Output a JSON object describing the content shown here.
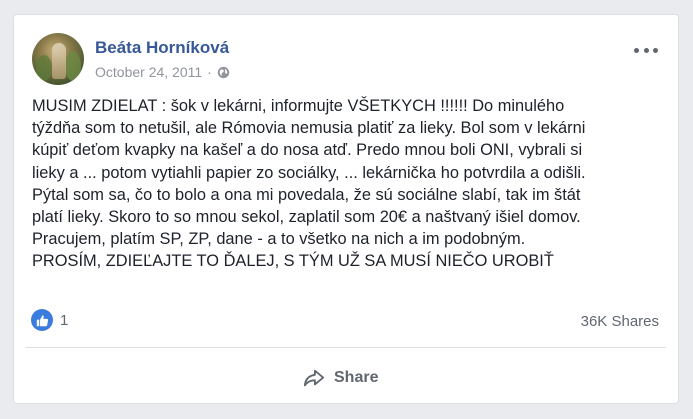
{
  "post": {
    "author_name": "Beáta Horníková",
    "date": "October 24, 2011",
    "separator": "·",
    "audience_icon": "globe-icon",
    "more_icon": "more-horizontal-icon",
    "text_lines": [
      "MUSIM ZDIELAT : šok v lekárni, informujte VŠETKYCH !!!!!! Do minulého",
      "týždňa som to netušil, ale Rómovia nemusia platiť za lieky. Bol som v lekárni",
      "kúpiť deťom kvapky na kašeľ a do nosa atď. Predo mnou boli ONI, vybrali si",
      "lieky a ... potom vytiahli papier zo sociálky, ... lekárnička ho potvrdila a odišli.",
      "Pýtal som sa, čo to bolo a ona mi povedala, že sú sociálne slabí, tak im štát",
      "platí lieky. Skoro to so mnou sekol, zaplatil som 20€ a naštvaný išiel domov.",
      "Pracujem, platím SP, ZP, dane - a to všetko na nich a im podobným.",
      "PROSÍM, ZDIEĽAJTE TO ĎALEJ, S TÝM UŽ SA MUSÍ NIEČO UROBIŤ"
    ]
  },
  "engagement": {
    "reaction_icon": "like-icon",
    "reaction_count": "1",
    "shares": "36K Shares"
  },
  "actions": {
    "share_icon": "share-icon",
    "share_label": "Share"
  },
  "colors": {
    "author_link": "#385898",
    "like_blue": "#3b7ddd",
    "muted_text": "#606770",
    "page_background": "#e9ebee"
  }
}
